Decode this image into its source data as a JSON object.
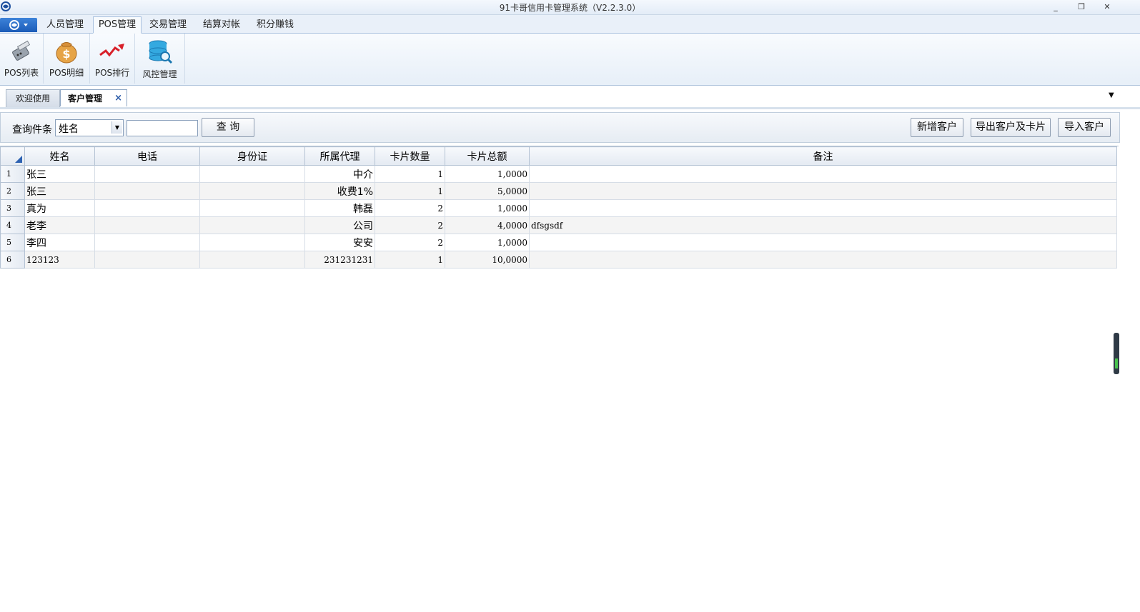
{
  "window": {
    "title": "91卡哥信用卡管理系统（V2.2.3.0）",
    "minimize_glyph": "_",
    "restore_glyph": "❐",
    "close_glyph": "✕"
  },
  "ribbon": {
    "app_menu_icon": "app-logo-icon",
    "tabs": [
      {
        "label": "人员管理"
      },
      {
        "label": "POS管理"
      },
      {
        "label": "交易管理"
      },
      {
        "label": "结算对帐"
      },
      {
        "label": "积分赚钱"
      }
    ],
    "active_tab": "POS管理",
    "buttons": [
      {
        "label": "POS列表",
        "icon": "pos-terminal-icon"
      },
      {
        "label": "POS明细",
        "icon": "money-bag-icon"
      },
      {
        "label": "POS排行",
        "icon": "trend-arrow-icon"
      },
      {
        "label": "风控管理",
        "icon": "database-search-icon"
      }
    ]
  },
  "doc_tabs": [
    {
      "label": "欢迎使用",
      "active": false
    },
    {
      "label": "客户管理",
      "active": true,
      "close": "×"
    }
  ],
  "query": {
    "label": "查询件条",
    "field_value": "姓名",
    "input_value": "",
    "search_button": "查 询",
    "add_button": "新增客户",
    "export_button": "导出客户及卡片",
    "import_button": "导入客户"
  },
  "grid": {
    "columns": [
      "姓名",
      "电话",
      "身份证",
      "所属代理",
      "卡片数量",
      "卡片总额",
      "备注"
    ],
    "rows": [
      {
        "no": "1",
        "name": "张三",
        "phone": "",
        "id": "",
        "agent": "中介",
        "count": "1",
        "total": "1,0000",
        "note": ""
      },
      {
        "no": "2",
        "name": "张三",
        "phone": "",
        "id": "",
        "agent": "收费1%",
        "count": "1",
        "total": "5,0000",
        "note": ""
      },
      {
        "no": "3",
        "name": "真为",
        "phone": "",
        "id": "",
        "agent": "韩磊",
        "count": "2",
        "total": "1,0000",
        "note": ""
      },
      {
        "no": "4",
        "name": "老李",
        "phone": "",
        "id": "",
        "agent": "公司",
        "count": "2",
        "total": "4,0000",
        "note": "dfsgsdf"
      },
      {
        "no": "5",
        "name": "李四",
        "phone": "",
        "id": "",
        "agent": "安安",
        "count": "2",
        "total": "1,0000",
        "note": ""
      },
      {
        "no": "6",
        "name": "123123",
        "phone": "",
        "id": "",
        "agent": "231231231",
        "count": "1",
        "total": "10,0000",
        "note": ""
      }
    ]
  },
  "colors": {
    "accent": "#2d62b2",
    "ribbon_bg": "#e9f0f9",
    "grid_border": "#b5c3d4"
  }
}
